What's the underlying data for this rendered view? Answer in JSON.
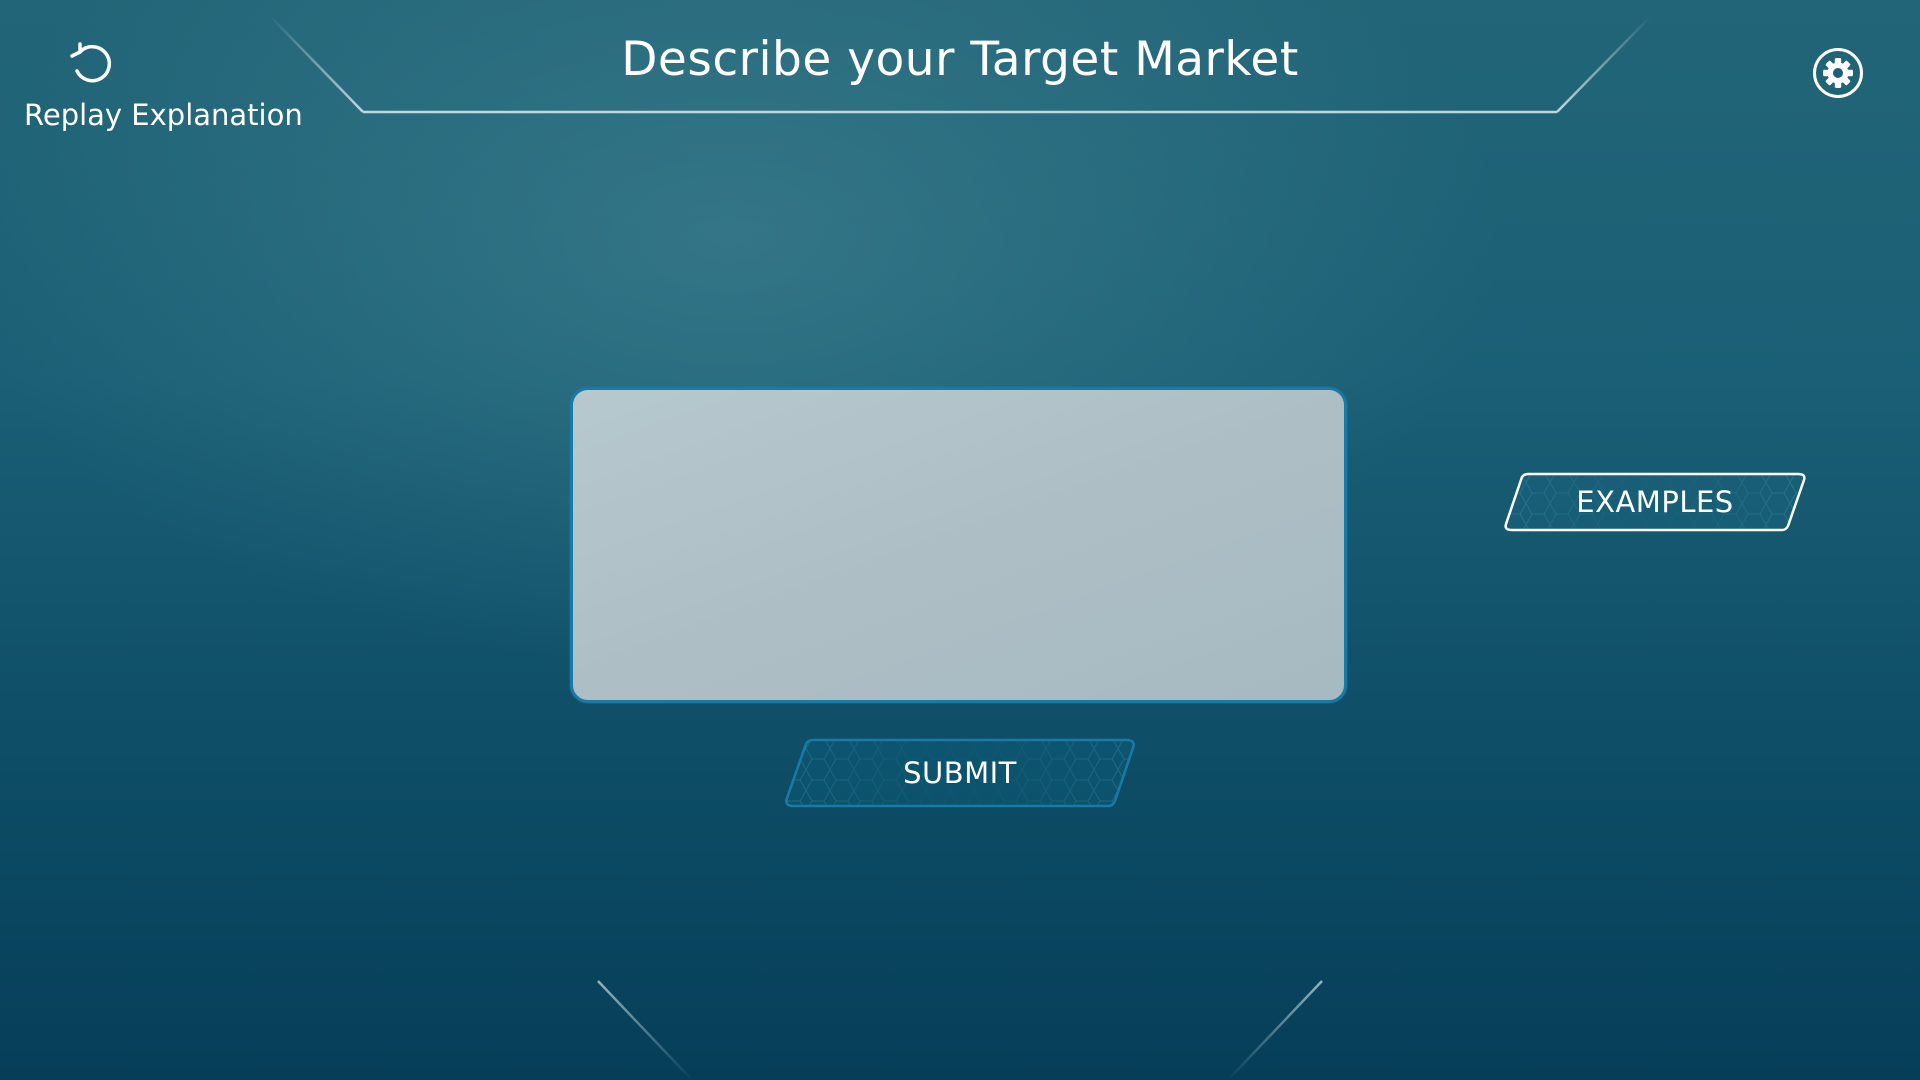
{
  "header": {
    "title": "Describe your Target Market",
    "replay_label": "Replay Explanation",
    "replay_icon": "replay-icon",
    "settings_icon": "gear-icon"
  },
  "form": {
    "answer_value": "",
    "examples_label": "EXAMPLES",
    "submit_label": "SUBMIT"
  },
  "colors": {
    "background_top": "#226578",
    "background_bottom": "#063e58",
    "accent_border": "#1a7aa6",
    "text_box_fill": "#b0c3c9",
    "frame_line": "#cfe3ea"
  }
}
